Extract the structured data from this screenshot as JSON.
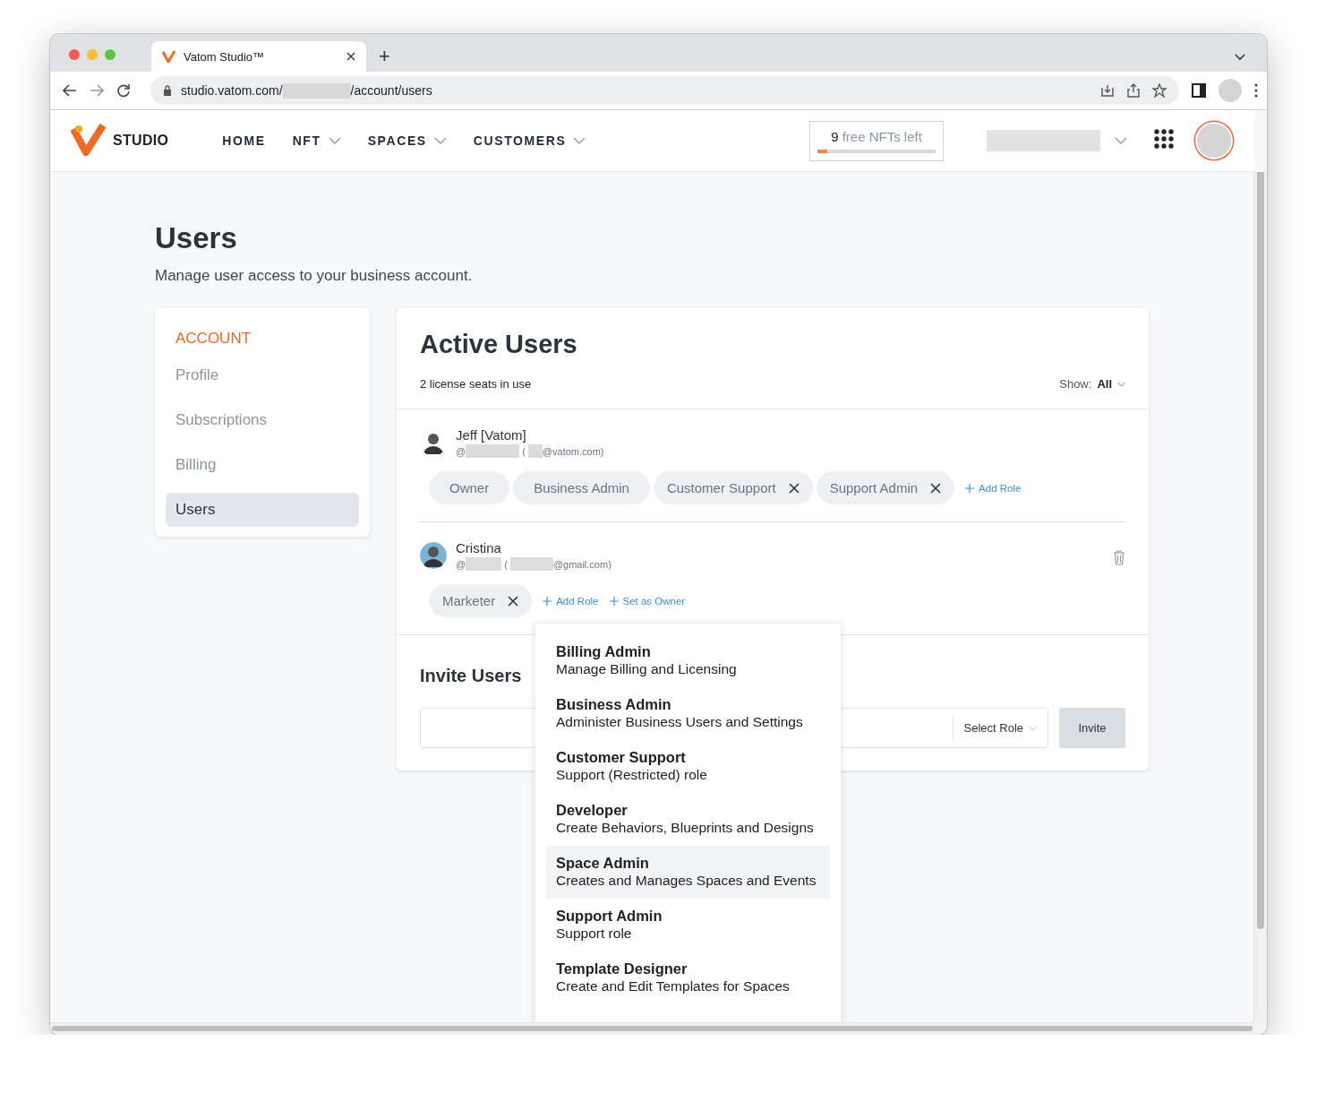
{
  "browser": {
    "tab_title": "Vatom Studio™",
    "new_tab": "+",
    "url_host": "studio.vatom.com/",
    "url_path": "/account/users"
  },
  "header": {
    "logo_text": "STUDIO",
    "nav": [
      {
        "label": "HOME",
        "has_menu": false
      },
      {
        "label": "NFT",
        "has_menu": true
      },
      {
        "label": "SPACES",
        "has_menu": true
      },
      {
        "label": "CUSTOMERS",
        "has_menu": true
      }
    ],
    "nft_quota": {
      "count": "9",
      "text": "free NFTs left",
      "level": 0.08
    }
  },
  "page": {
    "title": "Users",
    "subtitle": "Manage user access to your business account."
  },
  "sidebar": {
    "heading": "ACCOUNT",
    "items": [
      {
        "label": "Profile",
        "selected": false
      },
      {
        "label": "Subscriptions",
        "selected": false
      },
      {
        "label": "Billing",
        "selected": false
      },
      {
        "label": "Users",
        "selected": true
      }
    ]
  },
  "active_users": {
    "title": "Active Users",
    "seats": "2 license seats in use",
    "show_label": "Show:",
    "show_value": "All",
    "users": [
      {
        "name": "Jeff [Vatom]",
        "handle_prefix": "@",
        "email_open": "(",
        "email_suffix": "@vatom.com)",
        "deletable": false,
        "roles": [
          {
            "label": "Owner",
            "removable": false
          },
          {
            "label": "Business Admin",
            "removable": false
          },
          {
            "label": "Customer Support",
            "removable": true
          },
          {
            "label": "Support Admin",
            "removable": true
          }
        ],
        "actions": [
          "Add Role"
        ]
      },
      {
        "name": "Cristina",
        "handle_prefix": "@",
        "email_open": "(",
        "email_suffix": "@gmail.com)",
        "deletable": true,
        "roles": [
          {
            "label": "Marketer",
            "removable": true
          }
        ],
        "actions": [
          "Add Role",
          "Set as Owner"
        ]
      }
    ]
  },
  "invite": {
    "title": "Invite Users",
    "role_select": "Select Role",
    "button": "Invite"
  },
  "role_menu": [
    {
      "title": "Billing Admin",
      "description": "Manage Billing and Licensing",
      "highlighted": false
    },
    {
      "title": "Business Admin",
      "description": "Administer Business Users and Settings",
      "highlighted": false
    },
    {
      "title": "Customer Support",
      "description": "Support (Restricted) role",
      "highlighted": false
    },
    {
      "title": "Developer",
      "description": "Create Behaviors, Blueprints and Designs",
      "highlighted": false
    },
    {
      "title": "Space Admin",
      "description": "Creates and Manages Spaces and Events",
      "highlighted": true
    },
    {
      "title": "Support Admin",
      "description": "Support role",
      "highlighted": false
    },
    {
      "title": "Template Designer",
      "description": "Create and Edit Templates for Spaces",
      "highlighted": false
    }
  ]
}
